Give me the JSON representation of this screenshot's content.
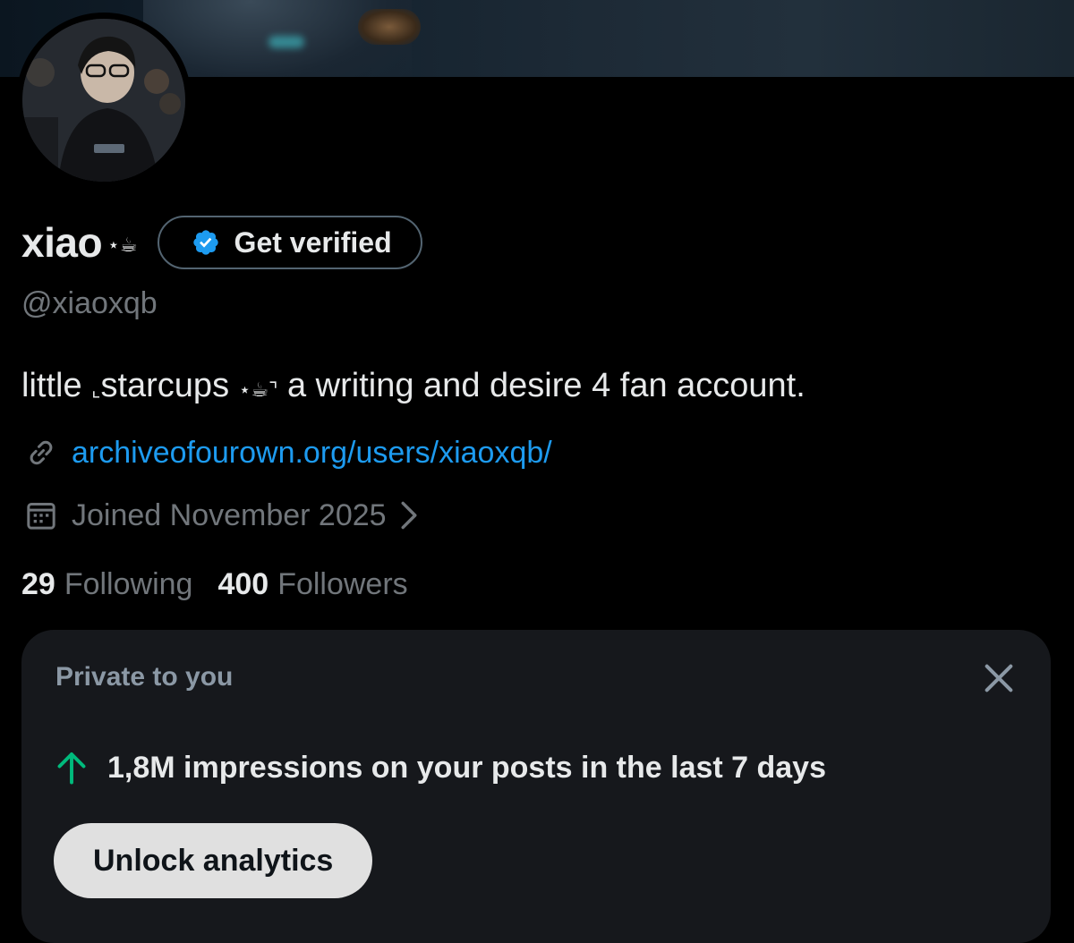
{
  "profile": {
    "display_name": "xiao",
    "name_emoji": "⋆☕︎",
    "handle": "@xiaoxqb",
    "get_verified_label": "Get verified",
    "bio": {
      "part1": "little ",
      "corner_open": "⌞",
      "part2": "starcups ",
      "emoji": "⋆☕︎",
      "corner_close": "⌝",
      "part3": " a writing and desire 4 fan account."
    },
    "link": "archiveofourown.org/users/xiaoxqb/",
    "joined": "Joined November 2025",
    "following_count": "29",
    "following_label": "Following",
    "followers_count": "400",
    "followers_label": "Followers"
  },
  "analytics_card": {
    "title": "Private to you",
    "impressions_text": "1,8M impressions on your posts in the last 7 days",
    "unlock_label": "Unlock analytics"
  },
  "icons": {
    "verified": "verified-badge-icon",
    "link": "link-icon",
    "calendar": "calendar-icon",
    "chevron": "chevron-right-icon",
    "close": "close-icon",
    "arrow_up": "arrow-up-icon"
  },
  "colors": {
    "background": "#000000",
    "primary_text": "#e7e9ea",
    "secondary_text": "#71767b",
    "link": "#1d9bf0",
    "verified_blue": "#1d9bf0",
    "trend_green": "#00ba7c",
    "card_bg": "#16181c",
    "button_bg": "#e0e0e0"
  }
}
